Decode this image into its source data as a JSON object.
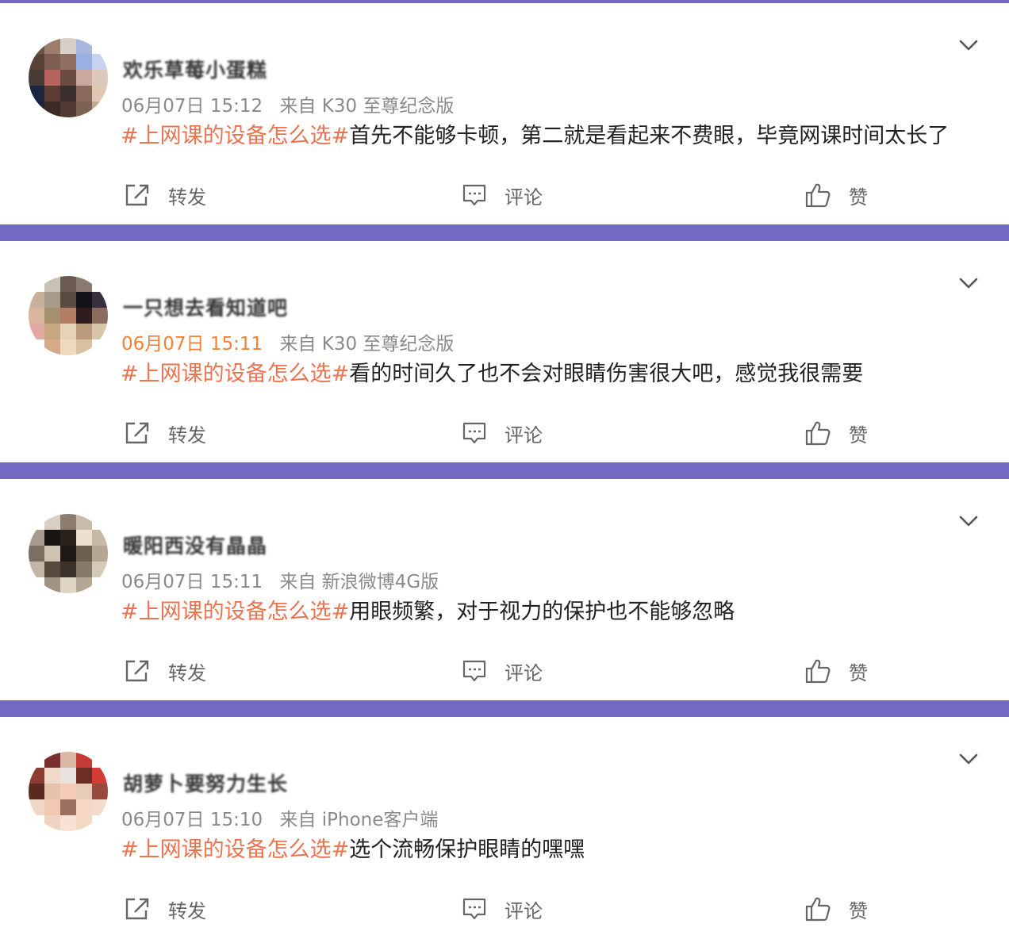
{
  "actions": {
    "repost": "转发",
    "comment": "评论",
    "like": "赞"
  },
  "icons": [
    "chevron-down-icon",
    "repost-icon",
    "comment-icon",
    "thumbs-up-icon"
  ],
  "colors": {
    "hashtag": "#eb7350",
    "highlight_time": "#f08237",
    "meta": "#8a8a8a",
    "separator": "#7469c2"
  },
  "posts": [
    {
      "username": "欢乐草莓小蛋糕",
      "time": "06月07日 15:12",
      "source": "来自 K30 至尊纪念版",
      "hashtag": "#上网课的设备怎么选#",
      "text": "首先不能够卡顿，第二就是看起来不费眼，毕竟网课时间太长了"
    },
    {
      "username": "一只想去看知道吧",
      "time": "06月07日 15:11",
      "source": "来自 K30 至尊纪念版",
      "hashtag": "#上网课的设备怎么选#",
      "text": "看的时间久了也不会对眼睛伤害很大吧，感觉我很需要"
    },
    {
      "username": "暖阳西没有晶晶",
      "time": "06月07日 15:11",
      "source": "来自 新浪微博4G版",
      "hashtag": "#上网课的设备怎么选#",
      "text": "用眼频繁，对于视力的保护也不能够忽略"
    },
    {
      "username": "胡萝卜要努力生长",
      "time": "06月07日 15:10",
      "source": "来自 iPhone客户端",
      "hashtag": "#上网课的设备怎么选#",
      "text": "选个流畅保护眼睛的嘿嘿"
    }
  ]
}
